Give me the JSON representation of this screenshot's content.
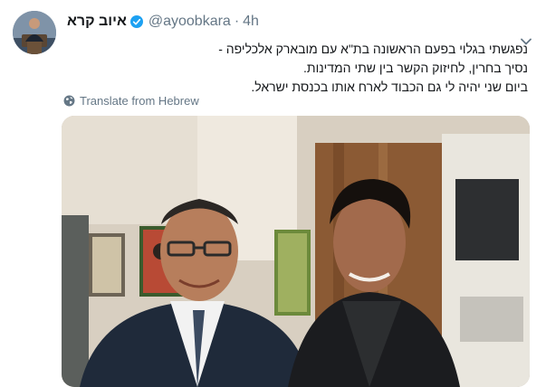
{
  "tweet": {
    "display_name": "איוב קרא",
    "handle": "@ayoobkara",
    "separator": "·",
    "time": "4h",
    "text_lines": [
      "נפגשתי בגלוי בפעם הראשונה בת\"א עם מובארק אלכליפה -",
      "נסיך בחרין, לחיזוק הקשר בין שתי המדינות.",
      "ביום שני יהיה לי גם הכבוד לארח אותו בכנסת ישראל."
    ],
    "translate_label": "Translate from Hebrew"
  },
  "icons": {
    "verified": "verified-badge-icon",
    "more": "chevron-down-icon",
    "translate": "globe-icon"
  },
  "colors": {
    "verified_blue": "#1da1f2",
    "secondary_text": "#657786",
    "primary_text": "#14171a"
  }
}
